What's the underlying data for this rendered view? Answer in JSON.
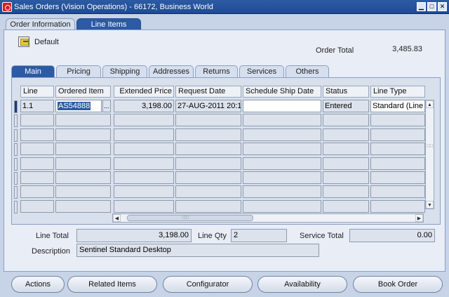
{
  "window": {
    "title": "Sales Orders (Vision Operations) - 66172, Business World",
    "minimize_glyph": "▁",
    "maximize_glyph": "□",
    "close_glyph": "✕"
  },
  "top_tabs": [
    {
      "label": "Order Information",
      "active": false
    },
    {
      "label": "Line Items",
      "active": true
    }
  ],
  "folder": {
    "label": "Default"
  },
  "order_total": {
    "label": "Order Total",
    "value": "3,485.83"
  },
  "sub_tabs": [
    {
      "label": "Main",
      "active": true
    },
    {
      "label": "Pricing",
      "active": false
    },
    {
      "label": "Shipping",
      "active": false
    },
    {
      "label": "Addresses",
      "active": false
    },
    {
      "label": "Returns",
      "active": false
    },
    {
      "label": "Services",
      "active": false
    },
    {
      "label": "Others",
      "active": false
    }
  ],
  "grid": {
    "columns": [
      "Line",
      "Ordered Item",
      "Extended Price",
      "Request Date",
      "Schedule Ship Date",
      "Status",
      "Line Type"
    ],
    "rows": [
      {
        "line": "1.1",
        "ordered_item": "AS54888",
        "extended_price": "3,198.00",
        "request_date": "27-AUG-2011 20:1",
        "schedule_ship_date": "",
        "status": "Entered",
        "line_type": "Standard (Line"
      }
    ],
    "lov_button": "...",
    "scroll_up": "▲",
    "scroll_down": "▼",
    "scroll_left": "◀",
    "scroll_right": "▶",
    "scroll_grip": "∷∷"
  },
  "footer": {
    "line_total_label": "Line Total",
    "line_total_value": "3,198.00",
    "line_qty_label": "Line Qty",
    "line_qty_value": "2",
    "service_total_label": "Service Total",
    "service_total_value": "0.00",
    "description_label": "Description",
    "description_value": "Sentinel Standard Desktop"
  },
  "buttons": [
    "Actions",
    "Related Items",
    "Configurator",
    "Availability",
    "Book Order"
  ]
}
